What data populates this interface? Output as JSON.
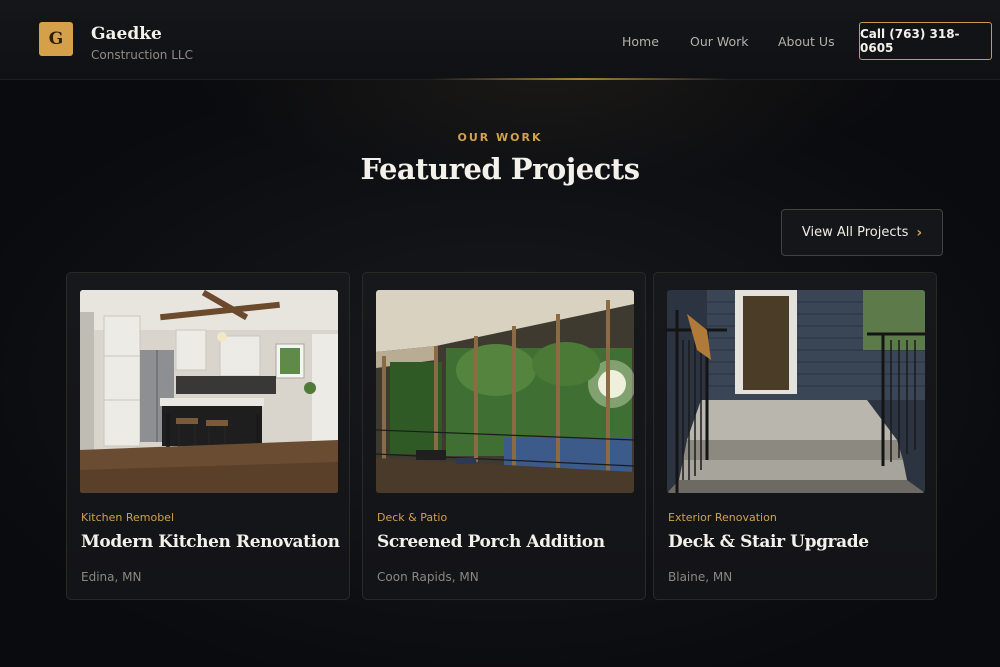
{
  "brand": {
    "logo_letter": "G",
    "name": "Gaedke",
    "subtitle": "Construction LLC",
    "accent_color": "#d4a14a"
  },
  "nav": {
    "items": [
      {
        "label": "Home"
      },
      {
        "label": "Our Work"
      },
      {
        "label": "About Us"
      }
    ],
    "call_label": "Call (763) 318-0605"
  },
  "section": {
    "eyebrow": "OUR WORK",
    "title": "Featured Projects",
    "view_all_label": "View All Projects",
    "view_all_icon": "chevron-right-icon"
  },
  "projects": [
    {
      "category": "Kitchen Remobel",
      "title": "Modern Kitchen Renovation",
      "location": "Edina, MN",
      "image": "kitchen-photo"
    },
    {
      "category": "Deck & Patio",
      "title": "Screened Porch Addition",
      "location": "Coon Rapids, MN",
      "image": "screened-porch-photo"
    },
    {
      "category": "Exterior Renovation",
      "title": "Deck & Stair Upgrade",
      "location": "Blaine, MN",
      "image": "deck-stairs-photo"
    }
  ]
}
